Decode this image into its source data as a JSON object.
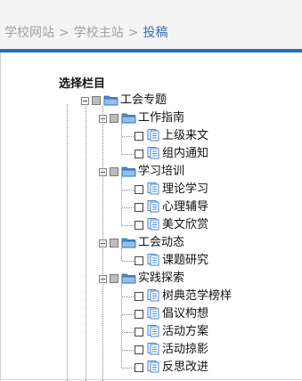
{
  "breadcrumb": {
    "items": [
      "学校网站",
      "学校主站"
    ],
    "current": "投稿",
    "separator": ">"
  },
  "tree": {
    "root_label": "选择栏目",
    "top": {
      "label": "工会专题",
      "children": [
        {
          "label": "工作指南",
          "children": [
            "上级来文",
            "组内通知"
          ]
        },
        {
          "label": "学习培训",
          "children": [
            "理论学习",
            "心理辅导",
            "美文欣赏"
          ]
        },
        {
          "label": "工会动态",
          "children": [
            "课题研究"
          ]
        },
        {
          "label": "实践探索",
          "children": [
            "树典范学榜样",
            "倡议构想",
            "活动方案",
            "活动掠影",
            "反思改进"
          ]
        }
      ]
    }
  },
  "colors": {
    "accent_bar": "#1f73b9",
    "current_link": "#2f73b8",
    "folder": "#4a8fd8",
    "page_icon": "#4a86c8"
  }
}
